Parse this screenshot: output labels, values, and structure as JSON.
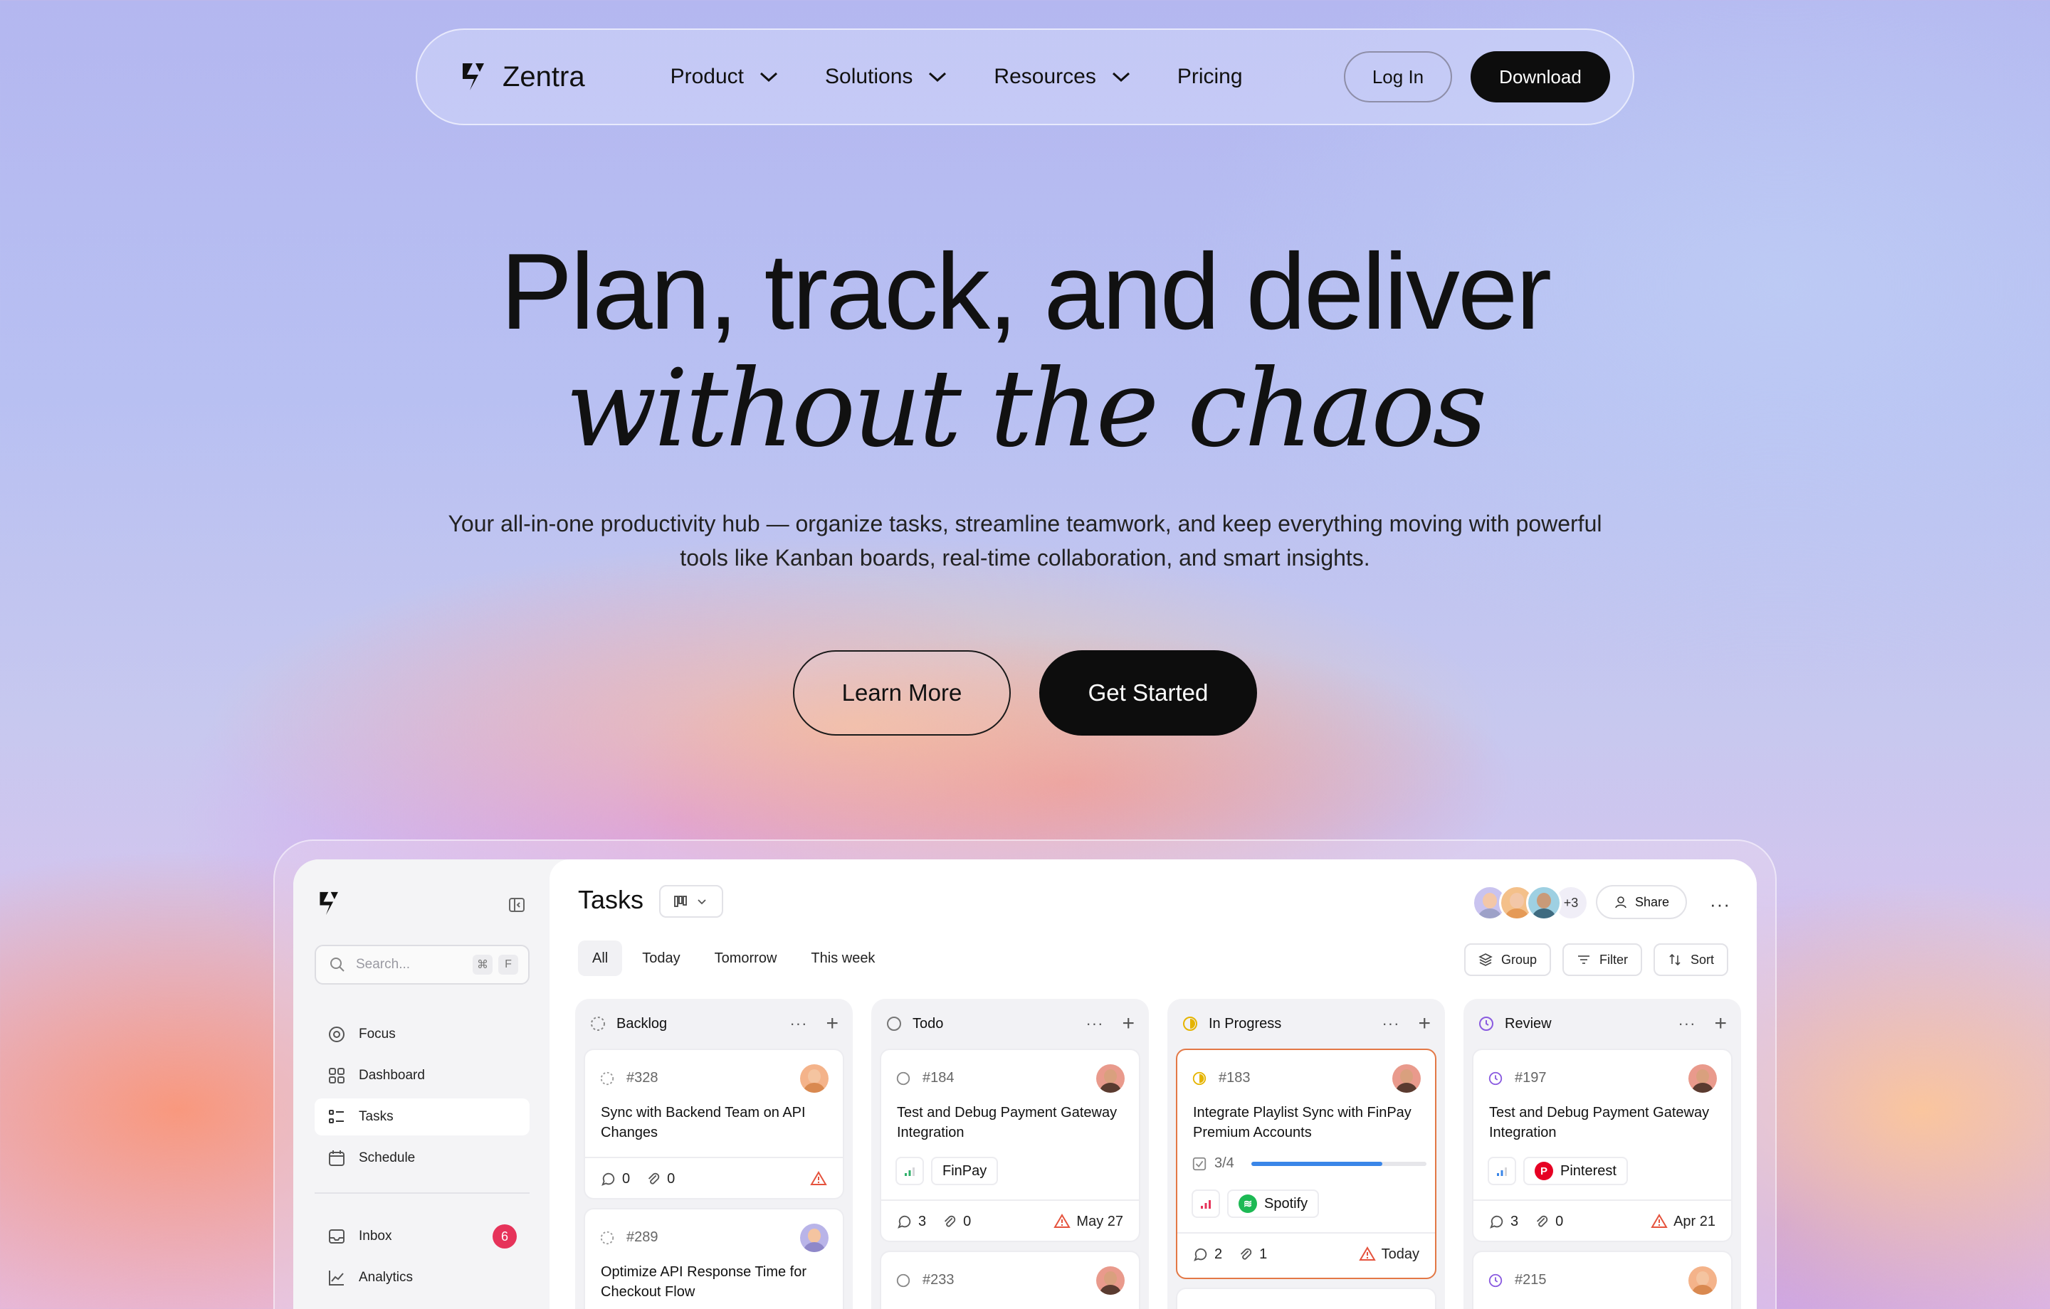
{
  "brand": {
    "name": "Zentra"
  },
  "nav": {
    "items": [
      {
        "label": "Product",
        "dropdown": true
      },
      {
        "label": "Solutions",
        "dropdown": true
      },
      {
        "label": "Resources",
        "dropdown": true
      },
      {
        "label": "Pricing",
        "dropdown": false
      }
    ],
    "login": "Log In",
    "download": "Download"
  },
  "hero": {
    "line1": "Plan, track, and deliver",
    "line2": "without the chaos",
    "subtitle": "Your all-in-one productivity hub — organize tasks, streamline teamwork, and keep everything moving with powerful tools like Kanban boards, real-time collaboration, and smart insights.",
    "learn": "Learn More",
    "start": "Get Started"
  },
  "app": {
    "search": {
      "placeholder": "Search...",
      "shortcut1": "⌘",
      "shortcut2": "F"
    },
    "sidebar": [
      {
        "label": "Focus",
        "icon": "target-icon"
      },
      {
        "label": "Dashboard",
        "icon": "grid-icon"
      },
      {
        "label": "Tasks",
        "icon": "list-icon",
        "active": true
      },
      {
        "label": "Schedule",
        "icon": "calendar-icon"
      },
      {
        "label": "Inbox",
        "icon": "inbox-icon",
        "badge": "6"
      },
      {
        "label": "Analytics",
        "icon": "chart-icon"
      }
    ],
    "title": "Tasks",
    "more_members": "+3",
    "share": "Share",
    "tabs": [
      "All",
      "Today",
      "Tomorrow",
      "This week"
    ],
    "tools": [
      "Group",
      "Filter",
      "Sort"
    ],
    "columns": [
      {
        "name": "Backlog",
        "cards": [
          {
            "id": "#328",
            "title": "Sync with Backend Team on API Changes",
            "comments": "0",
            "attachments": "0"
          },
          {
            "id": "#289",
            "title": "Optimize API Response Time for Checkout Flow"
          }
        ]
      },
      {
        "name": "Todo",
        "cards": [
          {
            "id": "#184",
            "title": "Test and Debug Payment Gateway Integration",
            "tag": "FinPay",
            "comments": "3",
            "attachments": "0",
            "due": "May 27"
          },
          {
            "id": "#233",
            "title": ""
          }
        ]
      },
      {
        "name": "In Progress",
        "cards": [
          {
            "id": "#183",
            "title": "Integrate Playlist Sync with FinPay Premium Accounts",
            "progress": "3/4",
            "progress_value": 0.75,
            "tag": "Spotify",
            "comments": "2",
            "attachments": "1",
            "due": "Today"
          }
        ]
      },
      {
        "name": "Review",
        "cards": [
          {
            "id": "#197",
            "title": "Test and Debug Payment Gateway Integration",
            "tag": "Pinterest",
            "comments": "3",
            "attachments": "0",
            "due": "Apr 21"
          },
          {
            "id": "#215",
            "title": ""
          }
        ]
      }
    ]
  },
  "colors": {
    "accent_dark": "#0d0d0d",
    "badge": "#e6335a",
    "warning": "#e5533d",
    "progress": "#3a86e8",
    "spotify": "#1db954",
    "pinterest": "#e60023",
    "highlight_border": "#e37846"
  }
}
